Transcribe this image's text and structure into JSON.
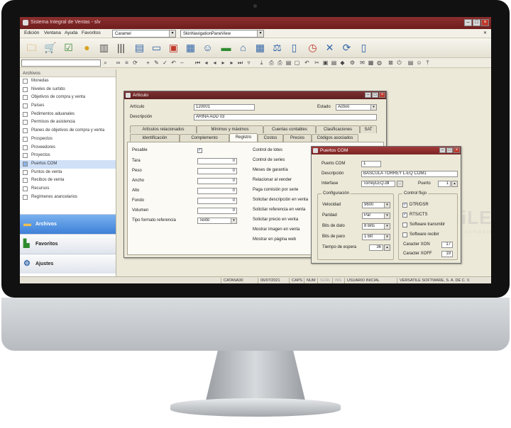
{
  "app": {
    "title": "Sistema Integral de Ventas - slv",
    "menu": [
      "Edición",
      "Ventana",
      "Ayuda",
      "Favoritos"
    ],
    "theme_combo": "Caramel",
    "skin_combo": "SkinNavigationPaneView"
  },
  "sidebar": {
    "header": "Archivos",
    "items": [
      "Monedas",
      "Niveles de surtido",
      "Objetivos de compra y venta",
      "Países",
      "Pedimentos aduanales",
      "Permisos de asistencia",
      "Planes de objetivos de compra y venta",
      "Prospectos",
      "Proveedores",
      "Proyectos",
      "Puertos COM",
      "Puntos de venta",
      "Recibos de venta",
      "Recursos",
      "Regímenes arancelarios"
    ],
    "selected_index": 10,
    "sections": [
      "Archivos",
      "Favoritos",
      "Ajustes"
    ]
  },
  "articulo": {
    "title": "Artículo",
    "articulo_label": "Artículo",
    "articulo_value": "120001",
    "estado_label": "Estado",
    "estado_value": "Activo",
    "descripcion_label": "Descripción",
    "descripcion_value": "ARINA ADD 03",
    "tabs_row1": [
      "Artículos relacionados",
      "Mínimos y máximos",
      "Cuentas contables",
      "Clasificaciones",
      "SAT"
    ],
    "tabs_row2": [
      "Identificación",
      "Complemento",
      "Registro",
      "Costos",
      "Precios",
      "Códigos asociados"
    ],
    "active_tab": "Registro",
    "fields": [
      {
        "label": "Pesable",
        "type": "check",
        "checked": true
      },
      {
        "label": "Tara",
        "value": "0"
      },
      {
        "label": "Peso",
        "value": "0"
      },
      {
        "label": "Ancho",
        "value": "0"
      },
      {
        "label": "Alto",
        "value": "0"
      },
      {
        "label": "Fondo",
        "value": "0"
      },
      {
        "label": "Volumen",
        "value": "0"
      }
    ],
    "tipo_formato_label": "Tipo formato referencia",
    "tipo_formato_value": "Texto",
    "right_labels": [
      "Control de lotes",
      "Control de series",
      "Meses de garantía",
      "Relacionar al vender",
      "Paga comisión por serie",
      "Solicitar descripción en venta",
      "Solicitar referencia en venta",
      "Solicitar precio en venta",
      "Mostrar imagen en venta",
      "Mostrar en página web"
    ]
  },
  "puertos": {
    "title": "Puertos COM",
    "puerto_com_label": "Puerto COM",
    "puerto_com_value": "1",
    "descripcion_label": "Descripción",
    "descripcion_value": "BASCULA TORREY L-EQ COM1",
    "interfase_label": "Interfase",
    "interfase_value": "TorreyLEQ.dll",
    "puerto_label": "Puerto",
    "puerto_value": "1",
    "config_title": "Configuración",
    "config": [
      {
        "label": "Velocidad",
        "value": "9600"
      },
      {
        "label": "Paridad",
        "value": "Par"
      },
      {
        "label": "Bits de dato",
        "value": "8 Bits"
      },
      {
        "label": "Bits de paro",
        "value": "1 Bit"
      },
      {
        "label": "Tiempo de espera",
        "value": "36"
      }
    ],
    "flujo_title": "Control flujo",
    "flujo": [
      {
        "label": "DTR/DSR",
        "checked": true
      },
      {
        "label": "RTS/CTS",
        "checked": true
      },
      {
        "label": "Software transmitir",
        "checked": false
      },
      {
        "label": "Software recibir",
        "checked": false
      }
    ],
    "xon_label": "Caracter XON",
    "xon_value": "17",
    "xoff_label": "Caracter XOFF",
    "xoff_value": "19"
  },
  "status": {
    "machine": "CATANA30",
    "date": "06/07/2021",
    "caps": "CAPS",
    "num": "NUM",
    "scrl": "SCRL",
    "ins": "INS",
    "user": "USUARIO INICIAL",
    "company": "VERSATILE SOFTWARE, S. A. DE C. V."
  },
  "watermark": {
    "text": "iLE",
    "sub": "software"
  }
}
